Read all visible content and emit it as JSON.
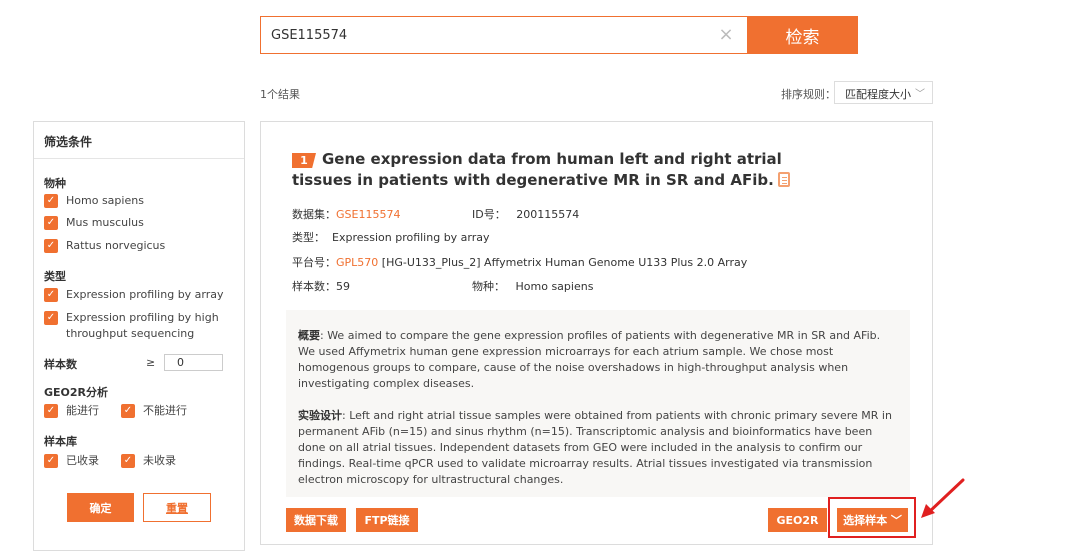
{
  "search": {
    "value": "GSE115574",
    "clear_icon": "×",
    "button_label": "检索"
  },
  "results": {
    "count_label": "1个结果"
  },
  "sort": {
    "label": "排序规则：",
    "selected": "匹配程度大小",
    "chevron": "﹀"
  },
  "filters": {
    "title": "筛选条件",
    "species": {
      "title": "物种",
      "items": [
        "Homo sapiens",
        "Mus musculus",
        "Rattus norvegicus"
      ]
    },
    "type": {
      "title": "类型",
      "items": [
        "Expression profiling by array",
        "Expression profiling by high throughput sequencing"
      ]
    },
    "sample_count": {
      "title": "样本数",
      "operator": "≥",
      "value": "0"
    },
    "geo2r": {
      "title": "GEO2R分析",
      "items": [
        "能进行",
        "不能进行"
      ]
    },
    "library": {
      "title": "样本库",
      "items": [
        "已收录",
        "未收录"
      ]
    },
    "confirm_label": "确定",
    "reset_label": "重置",
    "check_glyph": "✓"
  },
  "result": {
    "index": "1",
    "title": "Gene expression data from human left and right atrial tissues in patients with degenerative MR in SR and AFib.",
    "dataset_label": "数据集：",
    "dataset_value": "GSE115574",
    "id_label": "ID号：",
    "id_value": "200115574",
    "type_label": "类型：",
    "type_value": "Expression profiling by array",
    "platform_label": "平台号：",
    "platform_link": "GPL570",
    "platform_value": " [HG-U133_Plus_2] Affymetrix Human Genome U133 Plus 2.0 Array",
    "samples_label": "样本数：",
    "samples_value": "59",
    "species_label": "物种：",
    "species_value": "Homo sapiens",
    "summary_label": "概要",
    "summary_text": ": We aimed to compare the gene expression profiles of patients with degenerative MR in SR and AFib. We used Affymetrix human gene expression microarrays for each atrium sample. We chose most homogenous groups to compare, cause of the noise overshadows in high-throughput analysis when investigating complex diseases.",
    "design_label": "实验设计",
    "design_text": ": Left and right atrial tissue samples were obtained from patients with chronic primary severe MR in permanent AFib (n=15) and sinus rhythm (n=15). Transcriptomic analysis and bioinformatics have been done on all atrial tissues. Independent datasets from GEO were included in the analysis to confirm our findings. Real-time qPCR used to validate microarray results. Atrial tissues investigated via transmission electron microscopy for ultrastructural changes.",
    "buttons": {
      "download": "数据下载",
      "ftp": "FTP链接",
      "geo2r": "GEO2R",
      "select_samples": "选择样本",
      "select_chevron": "﹀"
    }
  },
  "colors": {
    "accent": "#f07030",
    "annotation": "#e02020"
  },
  "icons": {
    "clear": "close-icon",
    "copy": "copy-icon",
    "checkbox": "check-icon",
    "annotation_arrow": "arrow-icon"
  }
}
